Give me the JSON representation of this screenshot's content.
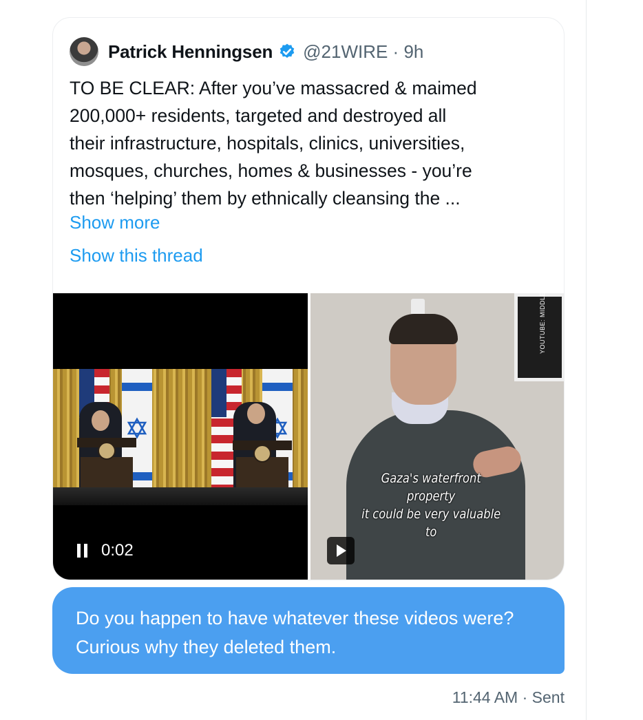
{
  "tweet": {
    "author_name": "Patrick Henningsen",
    "handle_line": "@21WIRE · 9h",
    "verified": true,
    "text": "TO BE CLEAR: After you’ve massacred & maimed\n200,000+ residents, targeted and destroyed all\ntheir infrastructure, hospitals, clinics, universities,\nmosques, churches, homes & businesses - you’re\nthen ‘helping’ them by ethnically cleansing the ...",
    "show_more_label": "Show more",
    "show_thread_label": "Show this thread",
    "media": {
      "video_left": {
        "status": "playing",
        "elapsed": "0:02"
      },
      "video_right": {
        "status": "paused",
        "caption": "Gaza's waterfront property\nit could be very valuable to",
        "watermark": "YOUTUBE: MIDDLE EAST INITIATIVE"
      }
    }
  },
  "message": {
    "text": "Do you happen to have whatever these videos were? Curious why they deleted them.",
    "time": "11:44 AM",
    "separator": "·",
    "status": "Sent"
  },
  "colors": {
    "link": "#1d9bf0",
    "bubble": "#4b9ff0",
    "verified": "#1d9bf0",
    "muted_text": "#536471"
  }
}
